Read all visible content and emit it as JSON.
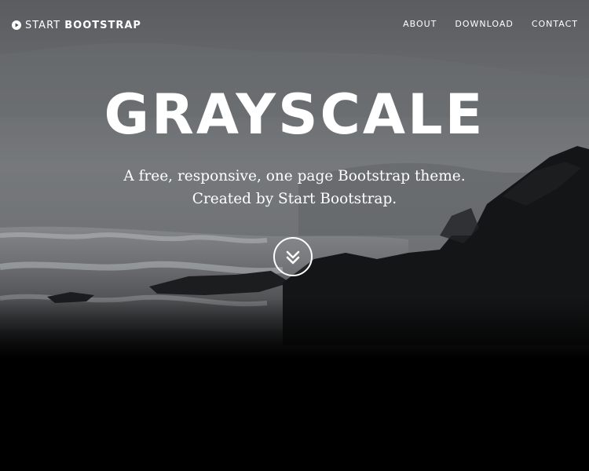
{
  "navbar": {
    "brand": {
      "icon": "play-circle-icon",
      "text_light": "START",
      "text_bold": "BOOTSTRAP"
    },
    "links": [
      {
        "label": "ABOUT"
      },
      {
        "label": "DOWNLOAD"
      },
      {
        "label": "CONTACT"
      }
    ]
  },
  "hero": {
    "title": "GRAYSCALE",
    "subtitle_line1": "A free, responsive, one page Bootstrap theme.",
    "subtitle_line2": "Created by Start Bootstrap.",
    "scroll_button_icon": "double-chevron-down-icon"
  },
  "colors": {
    "text": "#ffffff",
    "background": "#000000"
  }
}
